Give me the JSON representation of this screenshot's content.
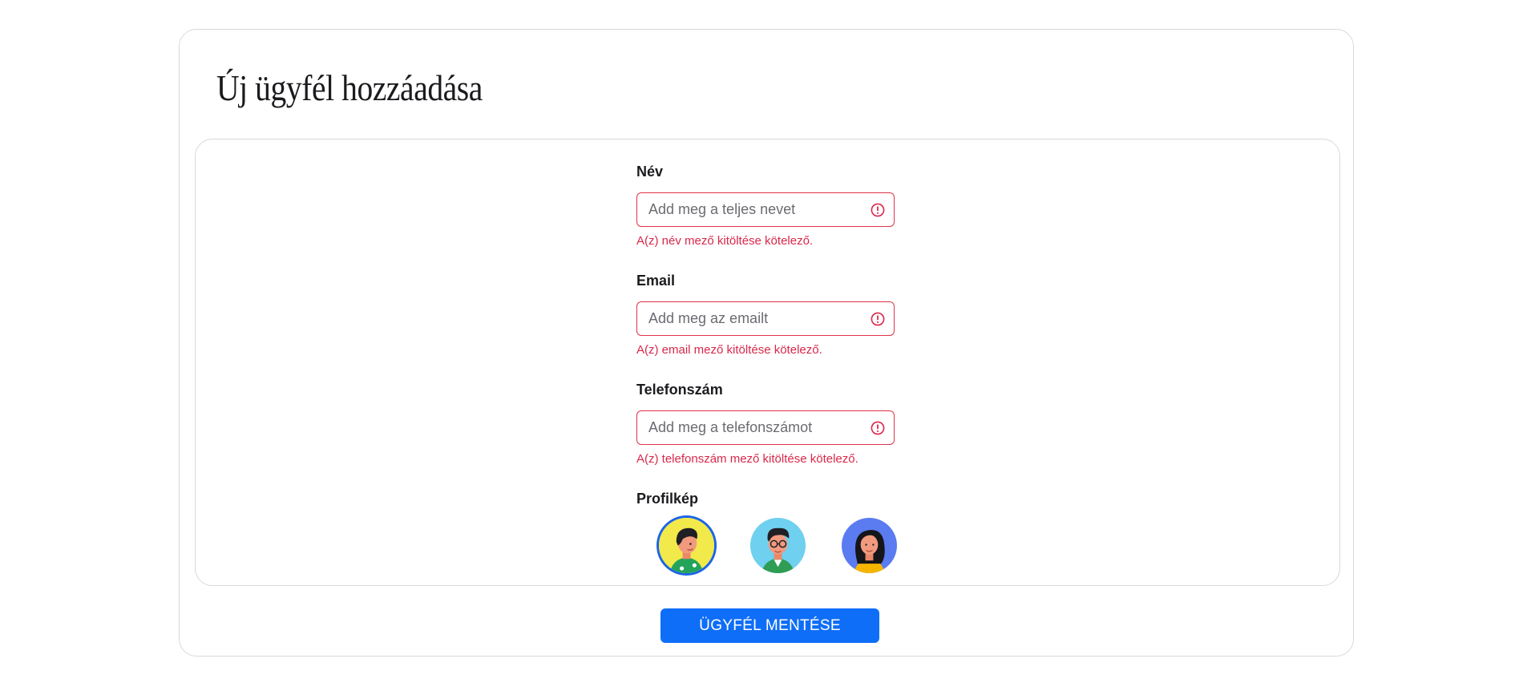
{
  "page": {
    "title": "Új ügyfél hozzáadása"
  },
  "form": {
    "name": {
      "label": "Név",
      "placeholder": "Add meg a teljes nevet",
      "value": "",
      "error": "A(z) név mező kitöltése kötelező."
    },
    "email": {
      "label": "Email",
      "placeholder": "Add meg az emailt",
      "value": "",
      "error": "A(z) email mező kitöltése kötelező."
    },
    "phone": {
      "label": "Telefonszám",
      "placeholder": "Add meg a telefonszámot",
      "value": "",
      "error": "A(z) telefonszám mező kitöltése kötelező."
    },
    "avatar": {
      "label": "Profilkép",
      "options": [
        "avatar-1-icon",
        "avatar-2-icon",
        "avatar-3-icon"
      ],
      "selected_index": 0
    }
  },
  "actions": {
    "save_label": "ÜGYFÉL MENTÉSE"
  },
  "colors": {
    "accent": "#0f6ef8",
    "error": "#d8284a",
    "selected_ring": "#1c64e8",
    "border": "#d9d9de"
  }
}
